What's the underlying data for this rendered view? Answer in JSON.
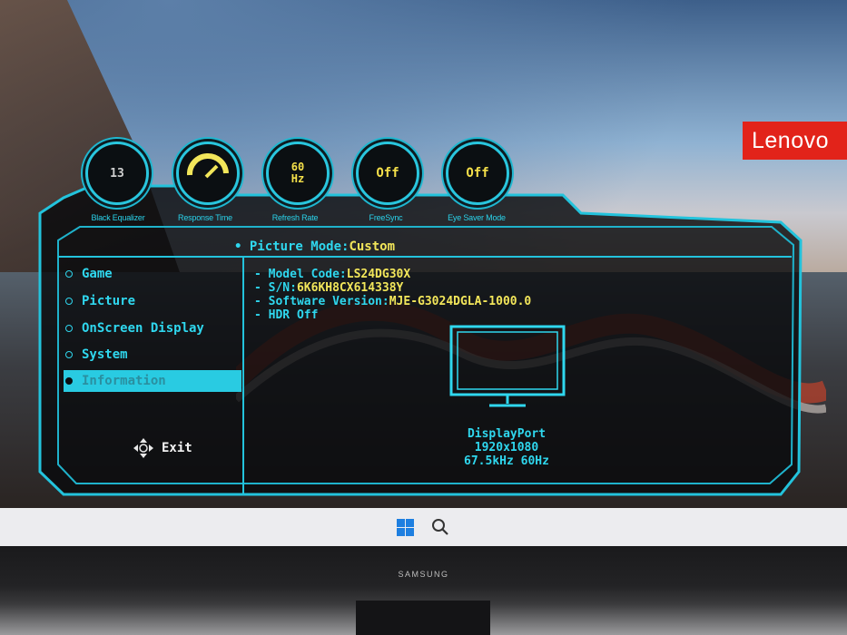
{
  "desktop": {
    "brand_logo": "Lenovo",
    "colors": {
      "logo_red": "#e2231a",
      "osd_cyan": "#2fd7ee",
      "osd_yellow": "#f2e65a",
      "taskbar": "#ececef"
    },
    "taskbar_icons": [
      "windows-start-icon",
      "search-icon"
    ]
  },
  "monitor": {
    "brand": "SAMSUNG"
  },
  "osd": {
    "dials": [
      {
        "value": "13",
        "label": "Black Equalizer",
        "icon": null
      },
      {
        "value": "",
        "label": "Response Time",
        "icon": "gauge-needle-icon"
      },
      {
        "value": "60\nHz",
        "label": "Refresh Rate",
        "icon": null
      },
      {
        "value": "Off",
        "label": "FreeSync",
        "icon": null
      },
      {
        "value": "Off",
        "label": "Eye Saver Mode",
        "icon": null
      }
    ],
    "picture_mode": {
      "label": "• Picture Mode:",
      "value": "Custom"
    },
    "menu": [
      {
        "label": "Game",
        "active": false
      },
      {
        "label": "Picture",
        "active": false
      },
      {
        "label": "OnScreen Display",
        "active": false
      },
      {
        "label": "System",
        "active": false
      },
      {
        "label": "Information",
        "active": true
      }
    ],
    "exit_label": "Exit",
    "info": [
      {
        "label": "- Model Code:",
        "value": "LS24DG30X"
      },
      {
        "label": "- S/N:",
        "value": "6K6KH8CX614338Y"
      },
      {
        "label": "- Software Version:",
        "value": "MJE-G3024DGLA-1000.0"
      },
      {
        "label": "- HDR Off",
        "value": ""
      }
    ],
    "port": {
      "name": "DisplayPort",
      "resolution": "1920x1080",
      "frequency": "67.5kHz 60Hz"
    }
  }
}
